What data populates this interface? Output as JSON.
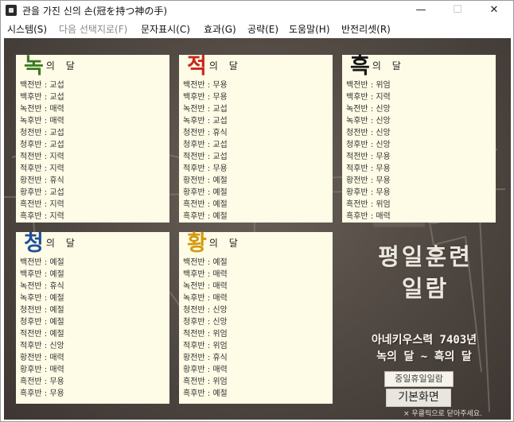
{
  "window": {
    "title": "관을 가진 신의 손(冠を持つ神の手)",
    "min_glyph": "—",
    "max_glyph": "☐",
    "close_glyph": "✕"
  },
  "menu": [
    {
      "label": "시스템(S)",
      "disabled": false
    },
    {
      "label": "다음 선택지로(F)",
      "disabled": true
    },
    {
      "label": "문자표시(C)",
      "disabled": false
    },
    {
      "label": "효과(G)",
      "disabled": false
    },
    {
      "label": "공략(E)",
      "disabled": false
    },
    {
      "label": "도움말(H)",
      "disabled": false
    },
    {
      "label": "반전리셋(R)",
      "disabled": false
    }
  ],
  "panels": [
    {
      "key": "green",
      "big": "녹",
      "rest": "의 달",
      "color": "#3a7a1f",
      "rows": [
        [
          "백전반",
          "교섭"
        ],
        [
          "백후반",
          "교섭"
        ],
        [
          "녹전반",
          "매력"
        ],
        [
          "녹후반",
          "매력"
        ],
        [
          "청전반",
          "교섭"
        ],
        [
          "청후반",
          "교섭"
        ],
        [
          "적전반",
          "지력"
        ],
        [
          "적후반",
          "지력"
        ],
        [
          "황전반",
          "휴식"
        ],
        [
          "황후반",
          "교섭"
        ],
        [
          "흑전반",
          "지력"
        ],
        [
          "흑후반",
          "지력"
        ]
      ]
    },
    {
      "key": "red",
      "big": "적",
      "rest": "의 달",
      "color": "#c8281e",
      "rows": [
        [
          "백전반",
          "무용"
        ],
        [
          "백후반",
          "무용"
        ],
        [
          "녹전반",
          "교섭"
        ],
        [
          "녹후반",
          "교섭"
        ],
        [
          "청전반",
          "휴식"
        ],
        [
          "청후반",
          "교섭"
        ],
        [
          "적전반",
          "교섭"
        ],
        [
          "적후반",
          "무용"
        ],
        [
          "황전반",
          "예절"
        ],
        [
          "황후반",
          "예절"
        ],
        [
          "흑전반",
          "예절"
        ],
        [
          "흑후반",
          "예절"
        ]
      ]
    },
    {
      "key": "black",
      "big": "흑",
      "rest": "의 달",
      "color": "#141414",
      "rows": [
        [
          "백전반",
          "위엄"
        ],
        [
          "백후반",
          "지력"
        ],
        [
          "녹전반",
          "신앙"
        ],
        [
          "녹후반",
          "신앙"
        ],
        [
          "청전반",
          "신앙"
        ],
        [
          "청후반",
          "신앙"
        ],
        [
          "적전반",
          "무용"
        ],
        [
          "적후반",
          "무용"
        ],
        [
          "황전반",
          "무용"
        ],
        [
          "황후반",
          "무용"
        ],
        [
          "흑전반",
          "위엄"
        ],
        [
          "흑후반",
          "매력"
        ]
      ]
    },
    {
      "key": "blue",
      "big": "청",
      "rest": "의 달",
      "color": "#1f4f9a",
      "rows": [
        [
          "백전반",
          "예절"
        ],
        [
          "백후반",
          "예절"
        ],
        [
          "녹전반",
          "휴식"
        ],
        [
          "녹후반",
          "예절"
        ],
        [
          "청전반",
          "예절"
        ],
        [
          "청후반",
          "예절"
        ],
        [
          "적전반",
          "예절"
        ],
        [
          "적후반",
          "신앙"
        ],
        [
          "황전반",
          "매력"
        ],
        [
          "황후반",
          "매력"
        ],
        [
          "흑전반",
          "무용"
        ],
        [
          "흑후반",
          "무용"
        ]
      ]
    },
    {
      "key": "yellow",
      "big": "황",
      "rest": "의 달",
      "color": "#d49a0e",
      "rows": [
        [
          "백전반",
          "예절"
        ],
        [
          "백후반",
          "매력"
        ],
        [
          "녹전반",
          "매력"
        ],
        [
          "녹후반",
          "매력"
        ],
        [
          "청전반",
          "신앙"
        ],
        [
          "청후반",
          "신앙"
        ],
        [
          "적전반",
          "위엄"
        ],
        [
          "적후반",
          "위엄"
        ],
        [
          "황전반",
          "휴식"
        ],
        [
          "황후반",
          "매력"
        ],
        [
          "흑전반",
          "위엄"
        ],
        [
          "흑후반",
          "예절"
        ]
      ]
    }
  ],
  "side": {
    "title_line1": "평일훈련",
    "title_line2": "일람",
    "sub1": "아네키우스력 7403년",
    "sub2": "녹의 달 ~ 흑의 달",
    "button1": "중일휴일일람",
    "button2": "기본화면",
    "hint": "× 우클릭으로 닫아주세요."
  }
}
